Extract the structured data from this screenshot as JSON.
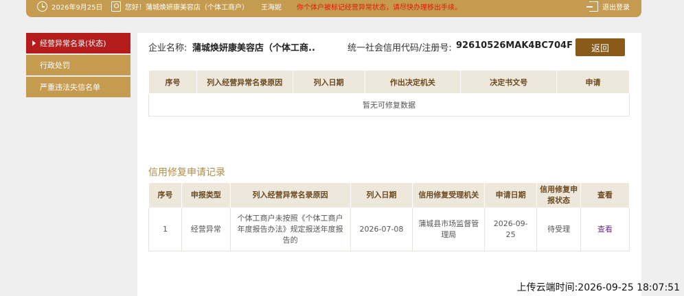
{
  "topbar": {
    "date": "2026年9月25日",
    "greeting": "您好！蒲城焕妍康美容店（个体工商户）",
    "user_name": "王海妮",
    "warning": "你个体户被标记经营异常状态，请尽快办理移出手续。",
    "logout_label": "退出登录"
  },
  "sidenav": {
    "items": [
      {
        "label": "经营异常名录(状态)"
      },
      {
        "label": "行政处罚"
      },
      {
        "label": "严重违法失信名单"
      }
    ]
  },
  "company": {
    "name_label": "企业名称:",
    "name_value": "蒲城焕妍康美容店（个体工商..",
    "code_label": "统一社会信用代码/注册号:",
    "code_value": "92610526MAK4BC704F",
    "back_label": "返回"
  },
  "repair_table": {
    "headers": [
      "序号",
      "列入经营异常名录原因",
      "列入日期",
      "作出决定机关",
      "决定书文号",
      "申请"
    ],
    "empty_text": "暂无可修复数据"
  },
  "records": {
    "title": "信用修复申请记录",
    "headers": [
      "序号",
      "申报类型",
      "列入经营异常名录原因",
      "列入日期",
      "信用修复受理机关",
      "申请日期",
      "信用修复申报状态",
      "查看"
    ],
    "rows": [
      {
        "index": "1",
        "type": "经营异常",
        "reason": "个体工商户未按照《个体工商户年度报告办法》规定报送年度报告的",
        "list_date": "2026-07-08",
        "agency": "蒲城县市场监督管理局",
        "apply_date": "2026-09-25",
        "status": "待受理",
        "view_label": "查看"
      }
    ]
  },
  "upload_time": "上传云端时间:2026-09-25 18:07:51",
  "colors": {
    "gold": "#c49b4f",
    "active_red": "#b51d1d",
    "back_button": "#8a5a1a",
    "warning_red": "#d81e06"
  }
}
